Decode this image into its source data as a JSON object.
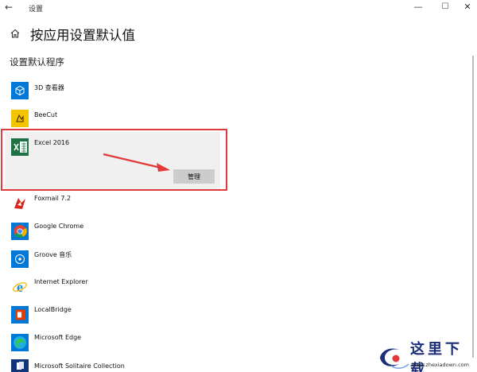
{
  "window": {
    "title": "设置",
    "back_glyph": "←",
    "minimize_glyph": "—",
    "maximize_glyph": "☐",
    "close_glyph": "✕"
  },
  "page": {
    "title": "按应用设置默认值",
    "section_heading": "设置默认程序"
  },
  "apps": [
    {
      "name": "3D 查看器",
      "icon": "3d-viewer-icon"
    },
    {
      "name": "BeeCut",
      "icon": "beecut-icon"
    },
    {
      "name": "Excel 2016",
      "icon": "excel-icon"
    },
    {
      "name": "Foxmail 7.2",
      "icon": "foxmail-icon"
    },
    {
      "name": "Google Chrome",
      "icon": "chrome-icon"
    },
    {
      "name": "Groove 音乐",
      "icon": "groove-icon"
    },
    {
      "name": "Internet Explorer",
      "icon": "ie-icon"
    },
    {
      "name": "LocalBridge",
      "icon": "office-icon"
    },
    {
      "name": "Microsoft Edge",
      "icon": "edge-icon"
    },
    {
      "name": "Microsoft Solitaire Collection",
      "icon": "solitaire-icon"
    }
  ],
  "selected_app": {
    "manage_label": "管理"
  },
  "colors": {
    "highlight": "#e03a3a",
    "accent": "#0078d7",
    "excel_green": "#1e7145"
  },
  "watermark": {
    "cn_text": "这里下载",
    "url_text": "www.zhexiadown.com"
  }
}
